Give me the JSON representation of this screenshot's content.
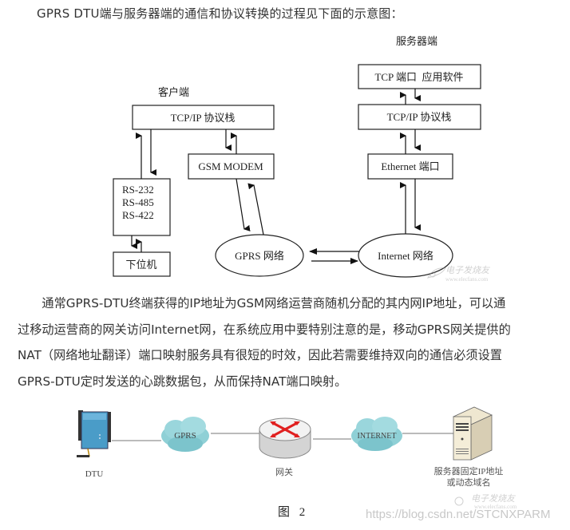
{
  "intro_text": "GPRS DTU端与服务器端的通信和协议转换的过程见下面的示意图：",
  "diagram1": {
    "client_label": "客户端",
    "server_label": "服务器端",
    "client_tcpip": "TCP/IP 协议栈",
    "gsm_modem": "GSM MODEM",
    "serial_lines": [
      "RS-232",
      "RS-485",
      "RS-422"
    ],
    "lower_machine": "下位机",
    "gprs_network": "GPRS 网络",
    "internet_network": "Internet 网络",
    "server_app": "TCP 端口  应用软件",
    "server_tcpip": "TCP/IP 协议栈",
    "ethernet_port": "Ethernet 端口",
    "watermark_cn": "电子发烧友",
    "watermark_url": "www.elecfans.com"
  },
  "paragraph": [
    "　　通常GPRS-DTU终端获得的IP地址为GSM网络运营商随机分配的其内网IP地址，可以通",
    "过移动运营商的网关访问Internet网，在系统应用中要特别注意的是，移动GPRS网关提供的",
    "NAT（网络地址翻译）端口映射服务具有很短的时效，因此若需要维持双向的通信必须设置",
    "GPRS-DTU定时发送的心跳数据包，从而保持NAT端口映射。"
  ],
  "diagram2": {
    "dtu_label": "DTU",
    "gprs_cloud": "GPRS",
    "gateway_label": "网关",
    "internet_cloud": "INTERNET",
    "server_label_line1": "服务器固定IP地址",
    "server_label_line2": "或动态域名",
    "watermark_cn": "电子发烧友",
    "watermark_url": "www.elecfans.com"
  },
  "figure_caption": "图 2",
  "csdn_watermark": "https://blog.csdn.net/STCNXPARM",
  "colors": {
    "text": "#333333",
    "cloud": "#8fd0d6",
    "router_arrow": "#e02020",
    "dtu_blue": "#4a9cc8",
    "watermark": "#c8c8c8"
  }
}
